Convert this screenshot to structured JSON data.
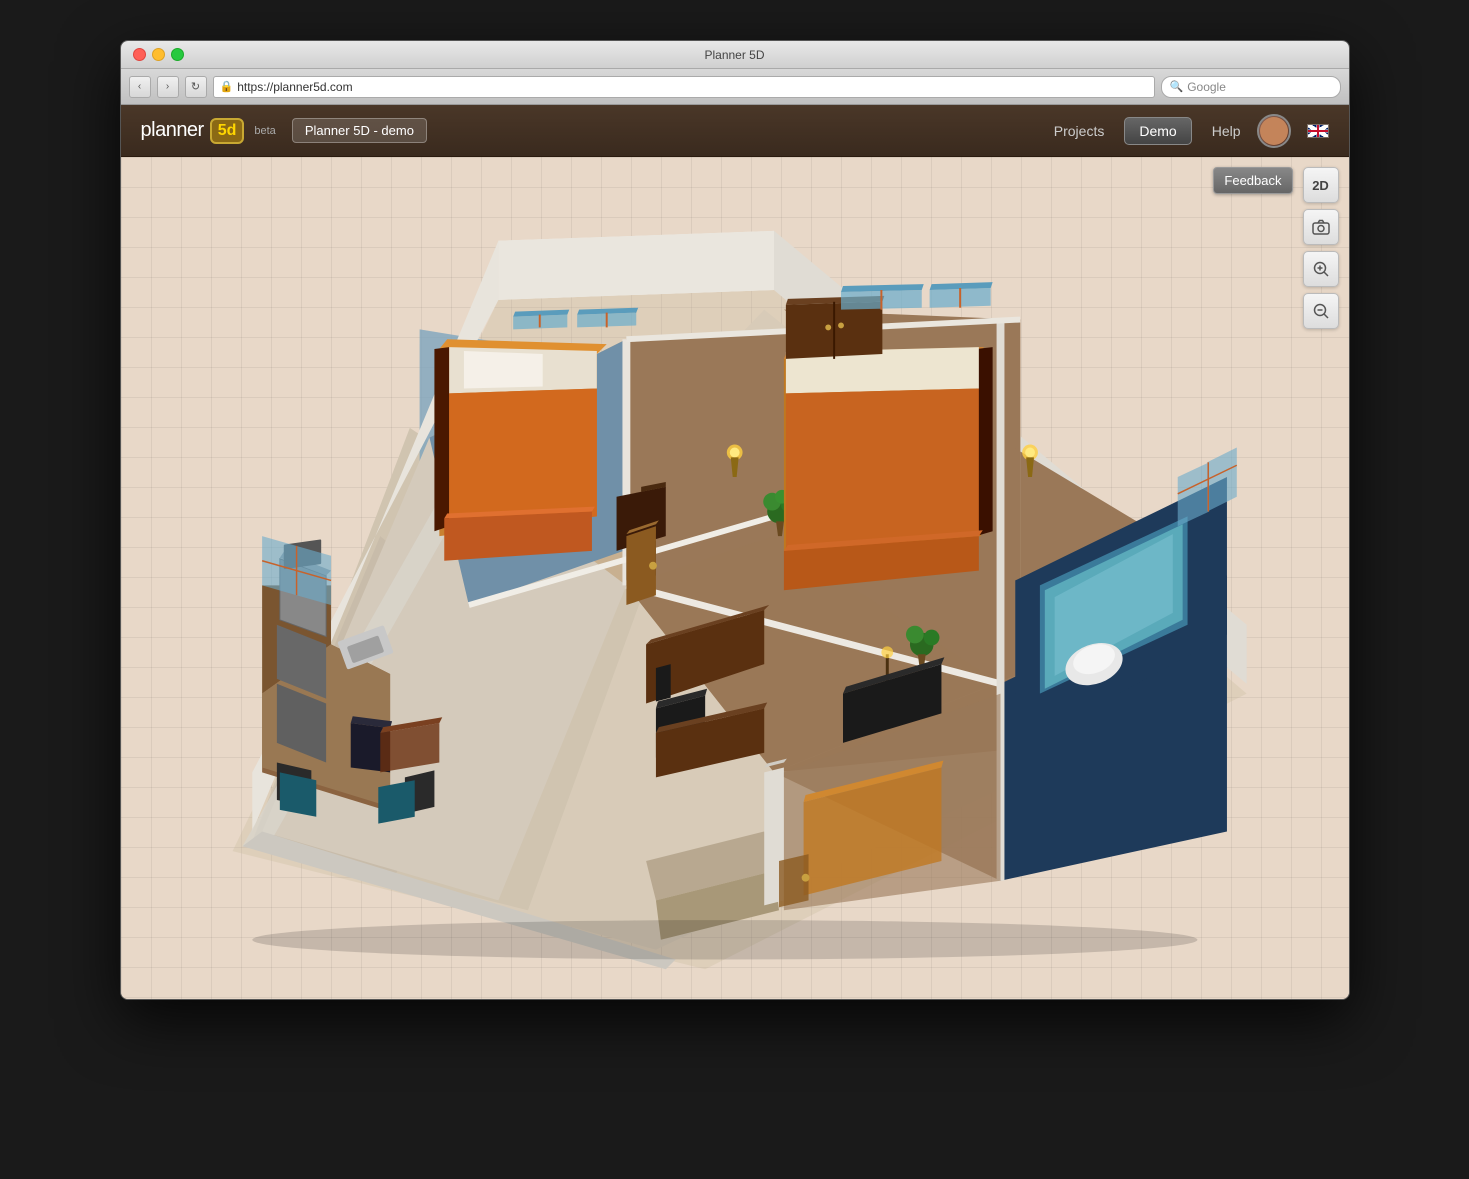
{
  "window": {
    "title": "Planner 5D",
    "traffic_lights": [
      "close",
      "minimize",
      "maximize"
    ]
  },
  "browser": {
    "back_label": "‹",
    "forward_label": "›",
    "refresh_label": "↻",
    "url": "https://planner5d.com",
    "search_placeholder": "Google"
  },
  "app": {
    "logo_text": "planner",
    "logo_badge": "5d",
    "beta_label": "beta",
    "project_name": "Planner 5D - demo",
    "nav_items": [
      {
        "label": "Projects",
        "active": false
      },
      {
        "label": "Demo",
        "active": true
      },
      {
        "label": "Help",
        "active": false
      }
    ]
  },
  "toolbar": {
    "feedback_label": "Feedback",
    "buttons": [
      {
        "label": "2D",
        "icon": "2d-icon",
        "active": false
      },
      {
        "icon": "camera-icon",
        "symbol": "📷",
        "active": false
      },
      {
        "icon": "zoom-in-icon",
        "symbol": "🔍+",
        "active": false
      },
      {
        "icon": "zoom-out-icon",
        "symbol": "🔍-",
        "active": false
      }
    ]
  },
  "colors": {
    "header_bg": "#3d2b1e",
    "canvas_bg": "#e8d8c8",
    "grid_line": "rgba(0,0,0,0.06)",
    "wall_color": "#f5f0e8",
    "floor_kitchen": "#d8d0c0",
    "floor_bedroom": "#4a7a9b",
    "floor_living": "#8B6914",
    "floor_bathroom": "#1a4a7a",
    "furniture_orange": "#d2691e",
    "furniture_dark": "#3d1e0a",
    "window_frame": "#c8622a"
  }
}
